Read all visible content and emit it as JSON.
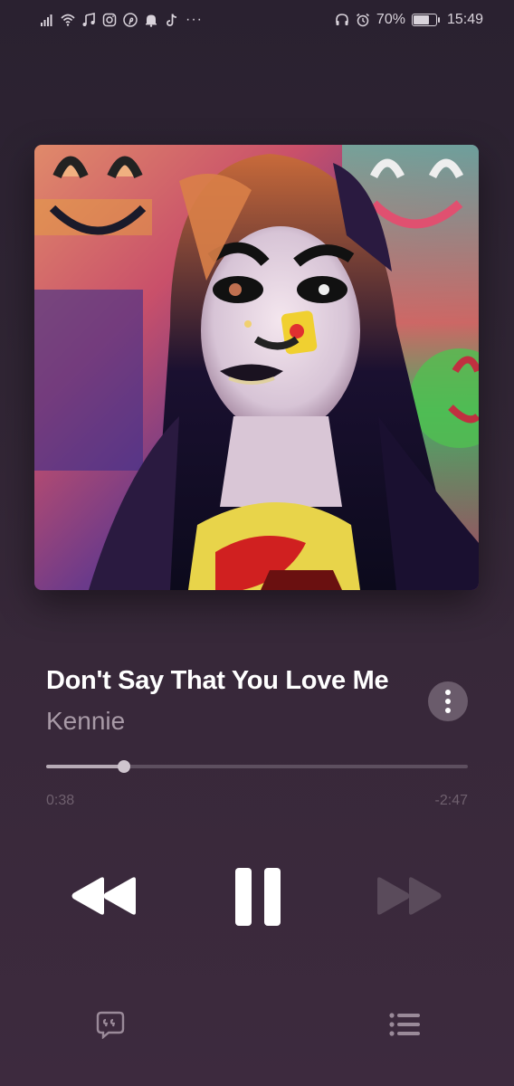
{
  "status_bar": {
    "battery_percent": "70%",
    "time": "15:49",
    "more_indicator": "···",
    "left_icons": [
      "signal-icon",
      "wifi-icon",
      "music-note-icon",
      "instagram-icon",
      "pinterest-icon",
      "bell-icon",
      "tiktok-icon"
    ],
    "right_icons": [
      "headphones-icon",
      "alarm-icon",
      "battery-icon"
    ],
    "battery_level": 0.7
  },
  "now_playing": {
    "title": "Don't Say That You Love Me",
    "artist": "Kennie",
    "elapsed": "0:38",
    "remaining": "-2:47",
    "progress_fraction": 0.185
  },
  "controls": {
    "rewind_icon": "rewind-icon",
    "pause_icon": "pause-icon",
    "forward_icon": "fast-forward-icon",
    "lyrics_icon": "lyrics-quote-icon",
    "queue_icon": "queue-list-icon",
    "more_icon": "more-vertical-icon"
  },
  "colors": {
    "accent_text": "#ffffff",
    "artist_text": "#a89aa7",
    "progress_fill": "#b7abb6",
    "disabled_control": "#5a4b5b"
  }
}
